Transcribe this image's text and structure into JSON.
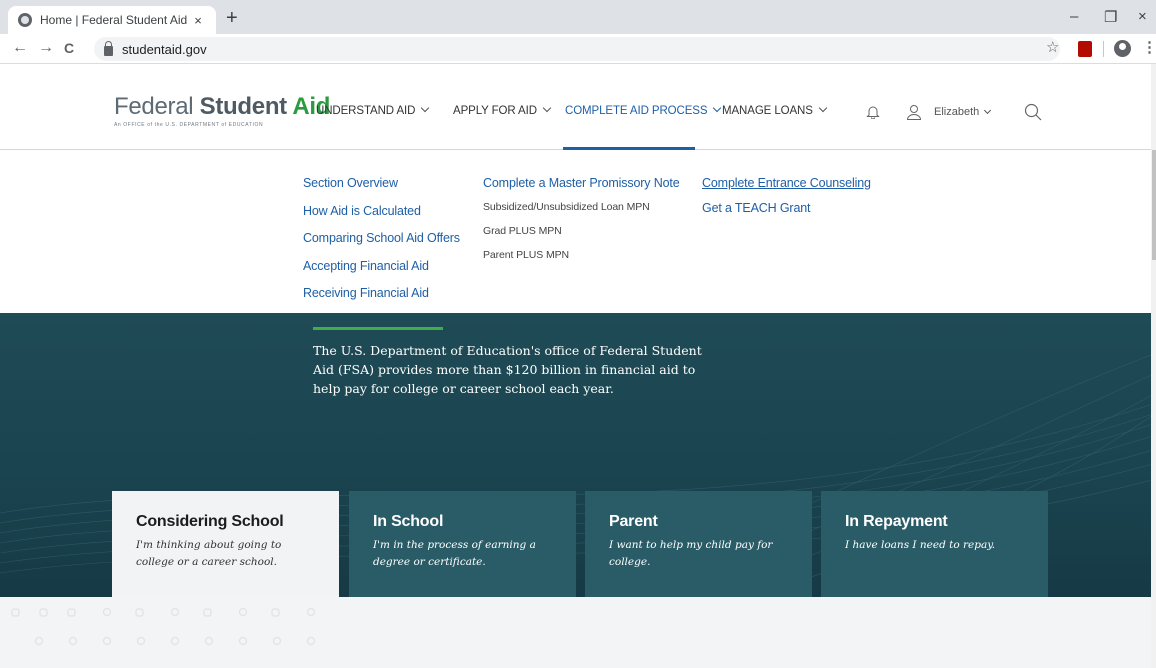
{
  "browser": {
    "tab_title": "Home | Federal Student Aid",
    "tab_close": "×",
    "new_tab": "+",
    "url": "studentaid.gov",
    "back": "←",
    "forward": "→",
    "reload": "C",
    "bookmark_star": "☆",
    "minimize": "–",
    "maximize": "❐",
    "close": "×",
    "menu": "⋮"
  },
  "header": {
    "logo_part1": "Federal ",
    "logo_part2": "Student ",
    "logo_part3": "Aid",
    "logo_sub": "An OFFICE of the U.S. DEPARTMENT of EDUCATION",
    "nav": [
      {
        "label": "UNDERSTAND AID"
      },
      {
        "label": "APPLY FOR AID"
      },
      {
        "label": "COMPLETE AID PROCESS"
      },
      {
        "label": "MANAGE LOANS"
      }
    ],
    "user_name": "Elizabeth"
  },
  "dropdown": {
    "col1": [
      "Section Overview",
      "How Aid is Calculated",
      "Comparing School Aid Offers",
      "Accepting Financial Aid",
      "Receiving Financial Aid"
    ],
    "col2_heading": "Complete a Master Promissory Note",
    "col2_items": [
      "Subsidized/Unsubsidized Loan MPN",
      "Grad PLUS MPN",
      "Parent PLUS MPN"
    ],
    "col3": [
      "Complete Entrance Counseling",
      "Get a TEACH Grant"
    ]
  },
  "hero": {
    "text": "The U.S. Department of Education's office of Federal Student Aid (FSA) provides more than $120 billion in financial aid to help pay for college or career school each year.",
    "cards": [
      {
        "title": "Considering School",
        "desc": "I'm thinking about going to college or a career school."
      },
      {
        "title": "In School",
        "desc": "I'm in the process of earning a degree or certificate."
      },
      {
        "title": "Parent",
        "desc": "I want to help my child pay for college."
      },
      {
        "title": "In Repayment",
        "desc": "I have loans I need to repay."
      }
    ]
  },
  "colors": {
    "brand_green": "#2c9b3f",
    "link_blue": "#1e5fa6",
    "hero_teal": "#1f4b56",
    "card_teal": "#2a5c68"
  },
  "icons": [
    "globe-icon",
    "lock-icon",
    "star-icon",
    "pdf-icon",
    "profile-icon",
    "bell-icon",
    "person-icon",
    "search-icon",
    "chevron-down-icon"
  ]
}
